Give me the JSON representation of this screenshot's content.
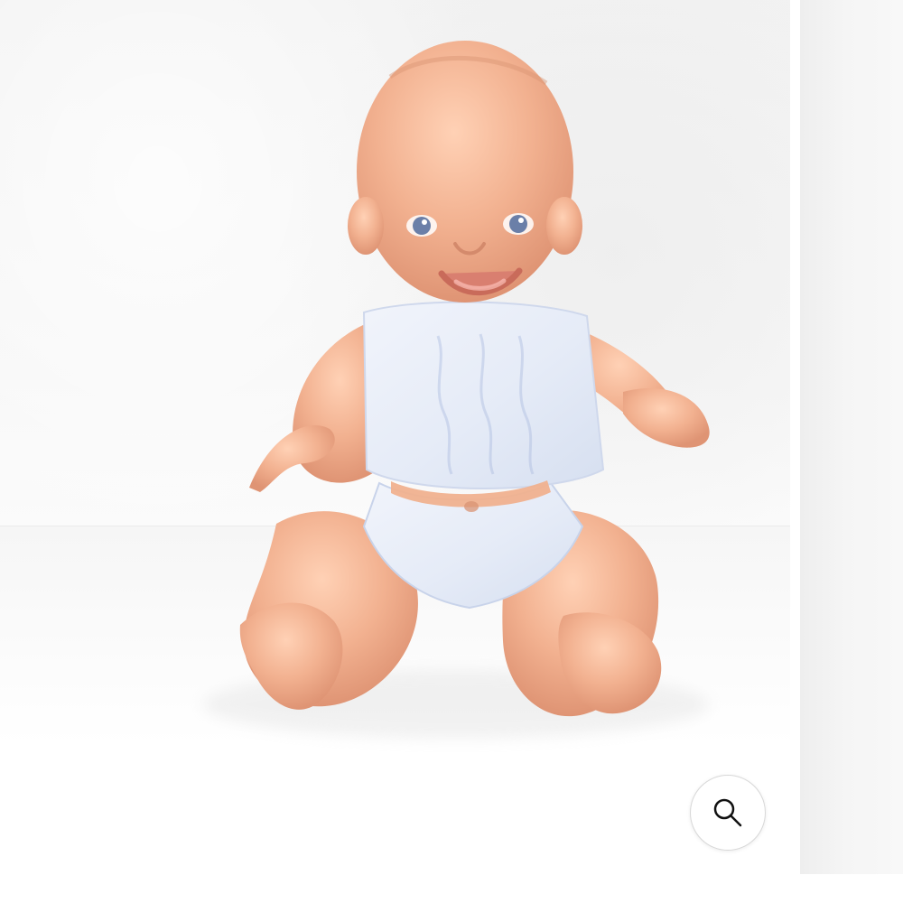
{
  "viewer": {
    "image_subject": "baby-doll-photo",
    "zoom_control": {
      "icon": "magnifier-icon"
    }
  },
  "colors": {
    "skin": "#f2b190",
    "skin_shadow": "#d9876e",
    "outfit": "#e8edf8",
    "outfit_shadow": "#c8d3ea",
    "eyes": "#6b7fa8",
    "icon_stroke": "#111111"
  }
}
